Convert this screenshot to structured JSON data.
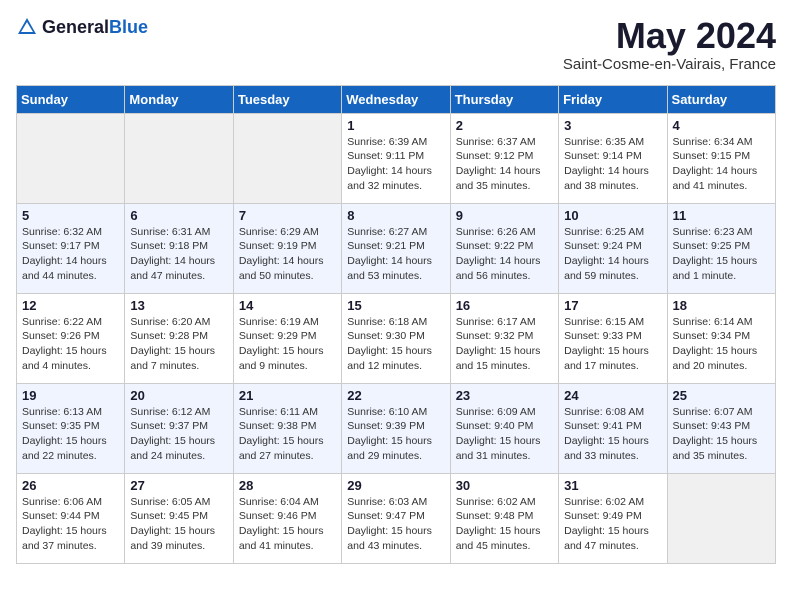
{
  "header": {
    "logo_general": "General",
    "logo_blue": "Blue",
    "month_title": "May 2024",
    "location": "Saint-Cosme-en-Vairais, France"
  },
  "weekdays": [
    "Sunday",
    "Monday",
    "Tuesday",
    "Wednesday",
    "Thursday",
    "Friday",
    "Saturday"
  ],
  "weeks": [
    [
      {
        "day": "",
        "empty": true
      },
      {
        "day": "",
        "empty": true
      },
      {
        "day": "",
        "empty": true
      },
      {
        "day": "1",
        "sunrise": "Sunrise: 6:39 AM",
        "sunset": "Sunset: 9:11 PM",
        "daylight": "Daylight: 14 hours and 32 minutes."
      },
      {
        "day": "2",
        "sunrise": "Sunrise: 6:37 AM",
        "sunset": "Sunset: 9:12 PM",
        "daylight": "Daylight: 14 hours and 35 minutes."
      },
      {
        "day": "3",
        "sunrise": "Sunrise: 6:35 AM",
        "sunset": "Sunset: 9:14 PM",
        "daylight": "Daylight: 14 hours and 38 minutes."
      },
      {
        "day": "4",
        "sunrise": "Sunrise: 6:34 AM",
        "sunset": "Sunset: 9:15 PM",
        "daylight": "Daylight: 14 hours and 41 minutes."
      }
    ],
    [
      {
        "day": "5",
        "sunrise": "Sunrise: 6:32 AM",
        "sunset": "Sunset: 9:17 PM",
        "daylight": "Daylight: 14 hours and 44 minutes."
      },
      {
        "day": "6",
        "sunrise": "Sunrise: 6:31 AM",
        "sunset": "Sunset: 9:18 PM",
        "daylight": "Daylight: 14 hours and 47 minutes."
      },
      {
        "day": "7",
        "sunrise": "Sunrise: 6:29 AM",
        "sunset": "Sunset: 9:19 PM",
        "daylight": "Daylight: 14 hours and 50 minutes."
      },
      {
        "day": "8",
        "sunrise": "Sunrise: 6:27 AM",
        "sunset": "Sunset: 9:21 PM",
        "daylight": "Daylight: 14 hours and 53 minutes."
      },
      {
        "day": "9",
        "sunrise": "Sunrise: 6:26 AM",
        "sunset": "Sunset: 9:22 PM",
        "daylight": "Daylight: 14 hours and 56 minutes."
      },
      {
        "day": "10",
        "sunrise": "Sunrise: 6:25 AM",
        "sunset": "Sunset: 9:24 PM",
        "daylight": "Daylight: 14 hours and 59 minutes."
      },
      {
        "day": "11",
        "sunrise": "Sunrise: 6:23 AM",
        "sunset": "Sunset: 9:25 PM",
        "daylight": "Daylight: 15 hours and 1 minute."
      }
    ],
    [
      {
        "day": "12",
        "sunrise": "Sunrise: 6:22 AM",
        "sunset": "Sunset: 9:26 PM",
        "daylight": "Daylight: 15 hours and 4 minutes."
      },
      {
        "day": "13",
        "sunrise": "Sunrise: 6:20 AM",
        "sunset": "Sunset: 9:28 PM",
        "daylight": "Daylight: 15 hours and 7 minutes."
      },
      {
        "day": "14",
        "sunrise": "Sunrise: 6:19 AM",
        "sunset": "Sunset: 9:29 PM",
        "daylight": "Daylight: 15 hours and 9 minutes."
      },
      {
        "day": "15",
        "sunrise": "Sunrise: 6:18 AM",
        "sunset": "Sunset: 9:30 PM",
        "daylight": "Daylight: 15 hours and 12 minutes."
      },
      {
        "day": "16",
        "sunrise": "Sunrise: 6:17 AM",
        "sunset": "Sunset: 9:32 PM",
        "daylight": "Daylight: 15 hours and 15 minutes."
      },
      {
        "day": "17",
        "sunrise": "Sunrise: 6:15 AM",
        "sunset": "Sunset: 9:33 PM",
        "daylight": "Daylight: 15 hours and 17 minutes."
      },
      {
        "day": "18",
        "sunrise": "Sunrise: 6:14 AM",
        "sunset": "Sunset: 9:34 PM",
        "daylight": "Daylight: 15 hours and 20 minutes."
      }
    ],
    [
      {
        "day": "19",
        "sunrise": "Sunrise: 6:13 AM",
        "sunset": "Sunset: 9:35 PM",
        "daylight": "Daylight: 15 hours and 22 minutes."
      },
      {
        "day": "20",
        "sunrise": "Sunrise: 6:12 AM",
        "sunset": "Sunset: 9:37 PM",
        "daylight": "Daylight: 15 hours and 24 minutes."
      },
      {
        "day": "21",
        "sunrise": "Sunrise: 6:11 AM",
        "sunset": "Sunset: 9:38 PM",
        "daylight": "Daylight: 15 hours and 27 minutes."
      },
      {
        "day": "22",
        "sunrise": "Sunrise: 6:10 AM",
        "sunset": "Sunset: 9:39 PM",
        "daylight": "Daylight: 15 hours and 29 minutes."
      },
      {
        "day": "23",
        "sunrise": "Sunrise: 6:09 AM",
        "sunset": "Sunset: 9:40 PM",
        "daylight": "Daylight: 15 hours and 31 minutes."
      },
      {
        "day": "24",
        "sunrise": "Sunrise: 6:08 AM",
        "sunset": "Sunset: 9:41 PM",
        "daylight": "Daylight: 15 hours and 33 minutes."
      },
      {
        "day": "25",
        "sunrise": "Sunrise: 6:07 AM",
        "sunset": "Sunset: 9:43 PM",
        "daylight": "Daylight: 15 hours and 35 minutes."
      }
    ],
    [
      {
        "day": "26",
        "sunrise": "Sunrise: 6:06 AM",
        "sunset": "Sunset: 9:44 PM",
        "daylight": "Daylight: 15 hours and 37 minutes."
      },
      {
        "day": "27",
        "sunrise": "Sunrise: 6:05 AM",
        "sunset": "Sunset: 9:45 PM",
        "daylight": "Daylight: 15 hours and 39 minutes."
      },
      {
        "day": "28",
        "sunrise": "Sunrise: 6:04 AM",
        "sunset": "Sunset: 9:46 PM",
        "daylight": "Daylight: 15 hours and 41 minutes."
      },
      {
        "day": "29",
        "sunrise": "Sunrise: 6:03 AM",
        "sunset": "Sunset: 9:47 PM",
        "daylight": "Daylight: 15 hours and 43 minutes."
      },
      {
        "day": "30",
        "sunrise": "Sunrise: 6:02 AM",
        "sunset": "Sunset: 9:48 PM",
        "daylight": "Daylight: 15 hours and 45 minutes."
      },
      {
        "day": "31",
        "sunrise": "Sunrise: 6:02 AM",
        "sunset": "Sunset: 9:49 PM",
        "daylight": "Daylight: 15 hours and 47 minutes."
      },
      {
        "day": "",
        "empty": true
      }
    ]
  ]
}
